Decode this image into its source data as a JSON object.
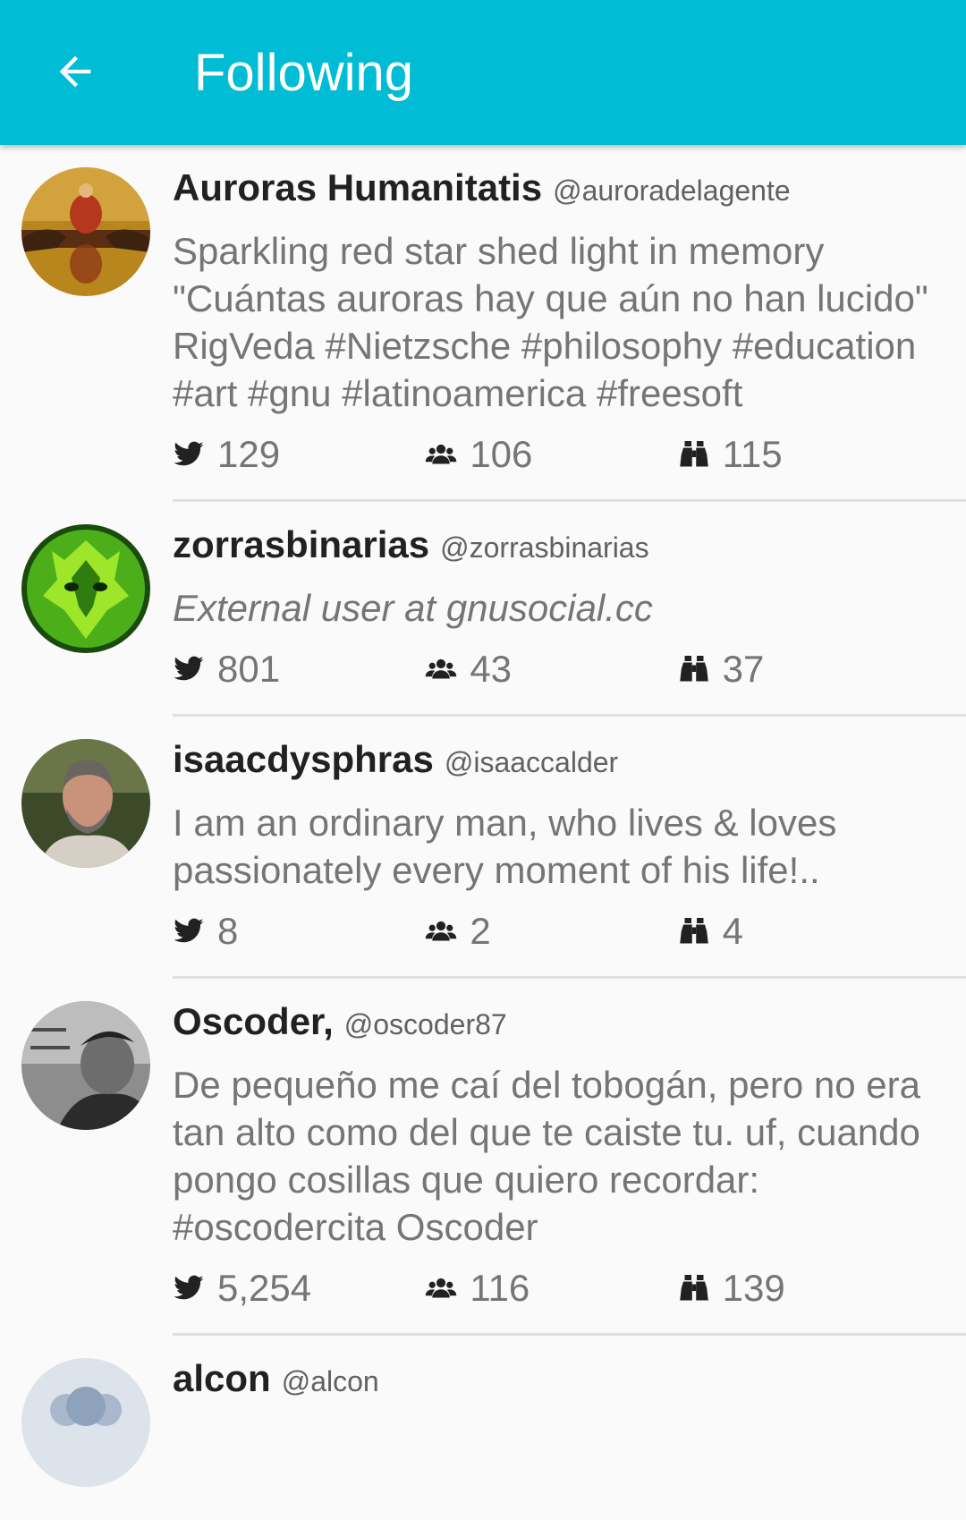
{
  "appbar": {
    "title": "Following",
    "color": "#00bcd4"
  },
  "users": [
    {
      "name": "Auroras Humanitatis",
      "handle": "@auroradelagente",
      "bio": "Sparkling red star shed light in memory \"Cuántas auroras hay que aún no han lucido\" RigVeda #Nietzsche #philosophy #education #art #gnu #latinoamerica #freesoft",
      "bio_style": "normal",
      "notices": "129",
      "followers": "106",
      "following": "115"
    },
    {
      "name": "zorrasbinarias",
      "handle": "@zorrasbinarias",
      "bio": "External user at gnusocial.cc",
      "bio_style": "italic",
      "notices": "801",
      "followers": "43",
      "following": "37"
    },
    {
      "name": "isaacdysphras",
      "handle": "@isaaccalder",
      "bio": "I am an ordinary man, who lives & loves passionately every moment of his life!..",
      "bio_style": "normal",
      "notices": "8",
      "followers": "2",
      "following": "4"
    },
    {
      "name": "Oscoder,",
      "handle": "@oscoder87",
      "bio": "De pequeño me caí del tobogán, pero no era tan alto como del que te caiste tu. uf, cuando pongo cosillas que quiero recordar: #oscodercita Oscoder",
      "bio_style": "normal",
      "notices": "5,254",
      "followers": "116",
      "following": "139"
    },
    {
      "name": "alcon",
      "handle": "@alcon"
    }
  ],
  "icons": {
    "back": "arrow-left-icon",
    "notices": "bird-icon",
    "followers": "group-icon",
    "following": "binoculars-icon"
  }
}
